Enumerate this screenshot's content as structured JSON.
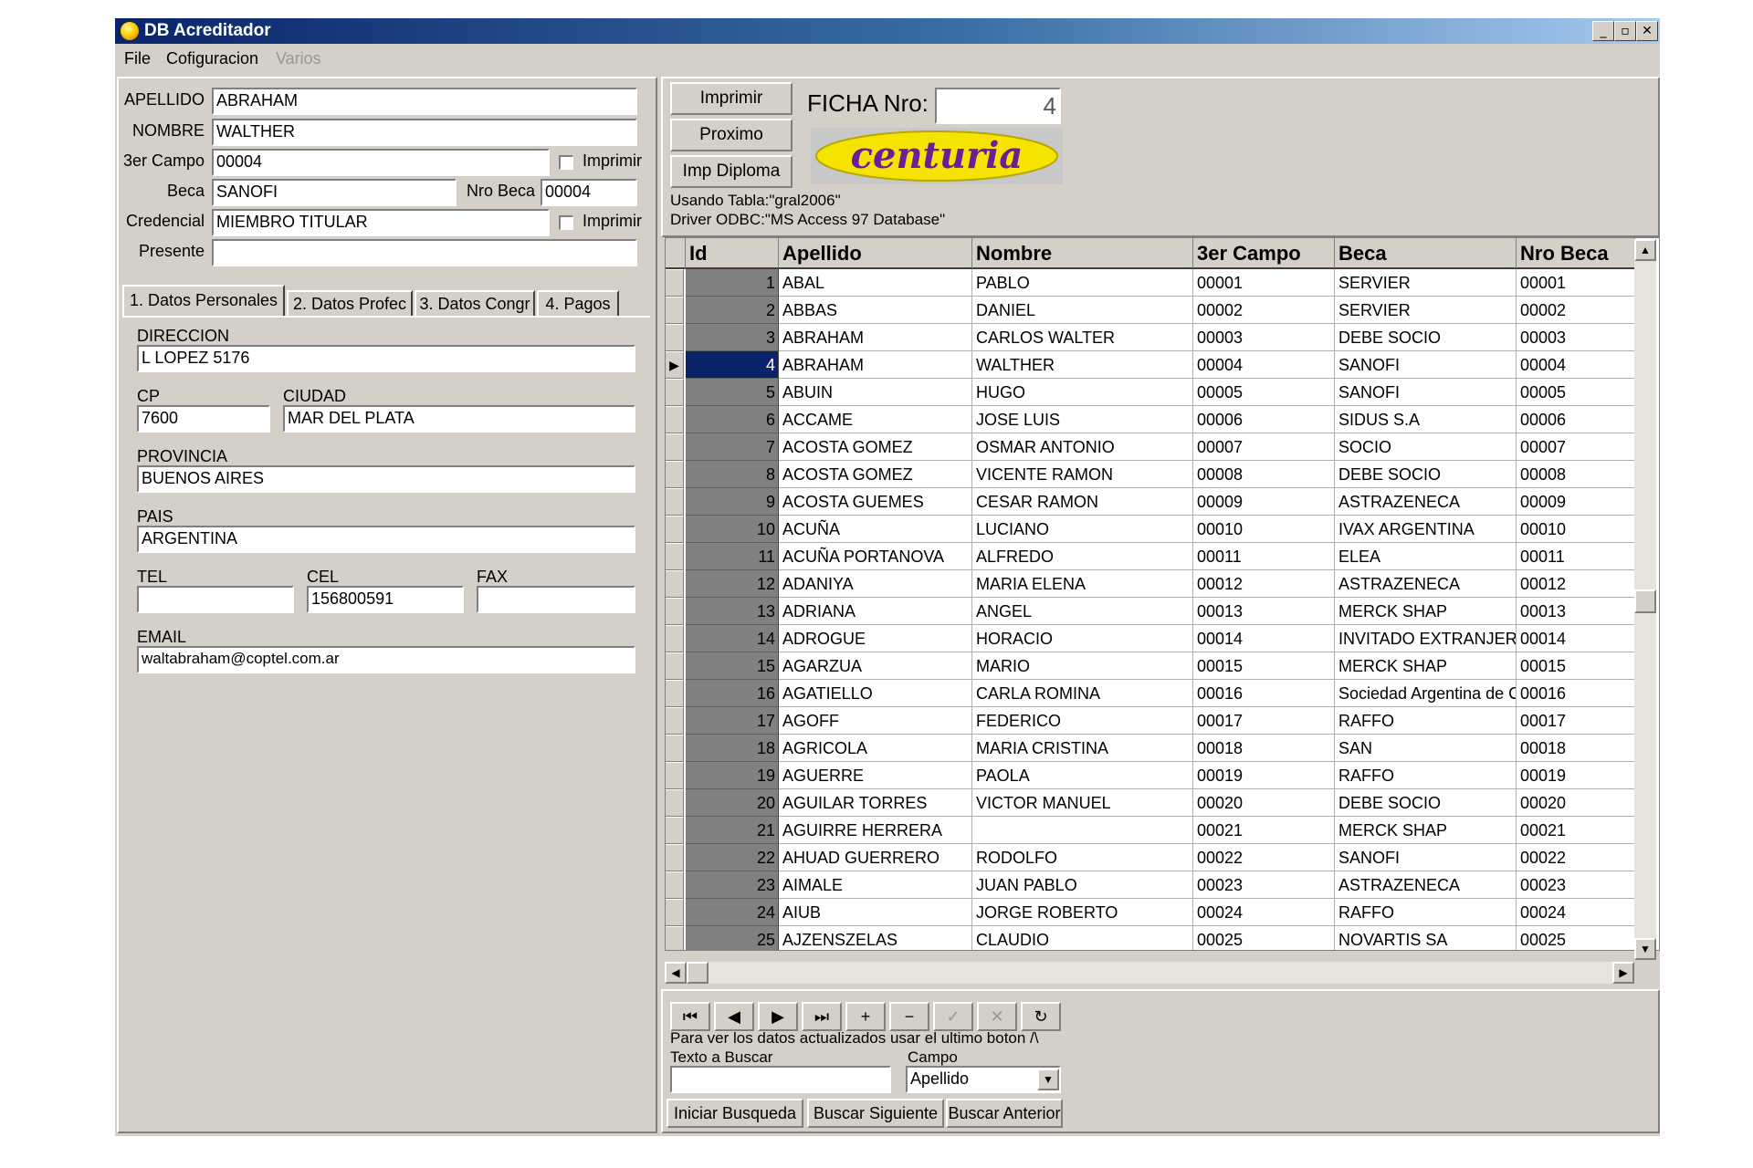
{
  "window": {
    "title": "DB Acreditador",
    "controls": [
      "_",
      "▫",
      "✕"
    ]
  },
  "menu": {
    "items": [
      "File",
      "Cofiguracion"
    ],
    "disabled": "Varios"
  },
  "form": {
    "apellido_label": "APELLIDO",
    "apellido": "ABRAHAM",
    "nombre_label": "NOMBRE",
    "nombre": "WALTHER",
    "campo3_label": "3er Campo",
    "campo3": "00004",
    "imprimir1": "Imprimir",
    "beca_label": "Beca",
    "beca": "SANOFI",
    "nrobeca_label": "Nro Beca",
    "nrobeca": "00004",
    "credencial_label": "Credencial",
    "credencial": "MIEMBRO TITULAR",
    "imprimir2": "Imprimir",
    "presente_label": "Presente",
    "presente": ""
  },
  "tabs": [
    "1. Datos Personales",
    "2. Datos Profec",
    "3. Datos Congr",
    "4. Pagos"
  ],
  "personal": {
    "direccion_label": "DIRECCION",
    "direccion": "L LOPEZ 5176",
    "cp_label": "CP",
    "cp": "7600",
    "ciudad_label": "CIUDAD",
    "ciudad": "MAR DEL PLATA",
    "provincia_label": "PROVINCIA",
    "provincia": "BUENOS AIRES",
    "pais_label": "PAIS",
    "pais": "ARGENTINA",
    "tel_label": "TEL",
    "tel": "",
    "cel_label": "CEL",
    "cel": "156800591",
    "fax_label": "FAX",
    "fax": "",
    "email_label": "EMAIL",
    "email": "waltabraham@coptel.com.ar"
  },
  "actions": {
    "imprimir": "Imprimir",
    "proximo": "Proximo",
    "imp_diploma": "Imp Diploma",
    "ficha_label": "FICHA Nro:",
    "ficha": "4",
    "logo": "centuria"
  },
  "info": {
    "tabla": "Usando Tabla:\"gral2006\"",
    "driver": "Driver ODBC:\"MS Access 97 Database\""
  },
  "grid": {
    "columns": [
      "Id",
      "Apellido",
      "Nombre",
      "3er Campo",
      "Beca",
      "Nro Beca"
    ],
    "selected_id": "4",
    "rows": [
      [
        "1",
        "ABAL",
        "PABLO",
        "00001",
        "SERVIER",
        "00001"
      ],
      [
        "2",
        "ABBAS",
        "DANIEL",
        "00002",
        "SERVIER",
        "00002"
      ],
      [
        "3",
        "ABRAHAM",
        "CARLOS WALTER",
        "00003",
        "DEBE SOCIO",
        "00003"
      ],
      [
        "4",
        "ABRAHAM",
        "WALTHER",
        "00004",
        "SANOFI",
        "00004"
      ],
      [
        "5",
        "ABUIN",
        "HUGO",
        "00005",
        "SANOFI",
        "00005"
      ],
      [
        "6",
        "ACCAME",
        "JOSE LUIS",
        "00006",
        "SIDUS S.A",
        "00006"
      ],
      [
        "7",
        "ACOSTA GOMEZ",
        "OSMAR ANTONIO",
        "00007",
        "SOCIO",
        "00007"
      ],
      [
        "8",
        "ACOSTA GOMEZ",
        "VICENTE RAMON",
        "00008",
        "DEBE SOCIO",
        "00008"
      ],
      [
        "9",
        "ACOSTA GUEMES",
        "CESAR RAMON",
        "00009",
        "ASTRAZENECA",
        "00009"
      ],
      [
        "10",
        "ACUÑA",
        "LUCIANO",
        "00010",
        "IVAX ARGENTINA",
        "00010"
      ],
      [
        "11",
        "ACUÑA PORTANOVA",
        "ALFREDO",
        "00011",
        "ELEA",
        "00011"
      ],
      [
        "12",
        "ADANIYA",
        "MARIA ELENA",
        "00012",
        "ASTRAZENECA",
        "00012"
      ],
      [
        "13",
        "ADRIANA",
        "ANGEL",
        "00013",
        "MERCK SHAP",
        "00013"
      ],
      [
        "14",
        "ADROGUE",
        "HORACIO",
        "00014",
        "INVITADO EXTRANJERO",
        "00014"
      ],
      [
        "15",
        "AGARZUA",
        "MARIO",
        "00015",
        "MERCK SHAP",
        "00015"
      ],
      [
        "16",
        "AGATIELLO",
        "CARLA ROMINA",
        "00016",
        "Sociedad Argentina de C",
        "00016"
      ],
      [
        "17",
        "AGOFF",
        "FEDERICO",
        "00017",
        "RAFFO",
        "00017"
      ],
      [
        "18",
        "AGRICOLA",
        "MARIA CRISTINA",
        "00018",
        "SAN",
        "00018"
      ],
      [
        "19",
        "AGUERRE",
        "PAOLA",
        "00019",
        "RAFFO",
        "00019"
      ],
      [
        "20",
        "AGUILAR TORRES",
        "VICTOR MANUEL",
        "00020",
        "DEBE SOCIO",
        "00020"
      ],
      [
        "21",
        "AGUIRRE HERRERA",
        "",
        "00021",
        "MERCK SHAP",
        "00021"
      ],
      [
        "22",
        "AHUAD GUERRERO",
        "RODOLFO",
        "00022",
        "SANOFI",
        "00022"
      ],
      [
        "23",
        "AIMALE",
        "JUAN PABLO",
        "00023",
        "ASTRAZENECA",
        "00023"
      ],
      [
        "24",
        "AIUB",
        "JORGE ROBERTO",
        "00024",
        "RAFFO",
        "00024"
      ],
      [
        "25",
        "AJZENSZELAS",
        "CLAUDIO",
        "00025",
        "NOVARTIS SA",
        "00025"
      ]
    ]
  },
  "navigator": {
    "buttons": [
      "first-icon",
      "prior-icon",
      "next-icon",
      "last-icon",
      "insert-icon",
      "delete-icon",
      "post-icon",
      "cancel-icon",
      "refresh-icon"
    ],
    "glyphs": [
      "⏮",
      "◀",
      "▶",
      "⏭",
      "+",
      "−",
      "✓",
      "✕",
      "↻"
    ]
  },
  "search": {
    "hint": "Para ver los datos actualizados usar el ultimo boton /\\",
    "texto_label": "Texto a Buscar",
    "texto": "",
    "campo_label": "Campo",
    "campo": "Apellido",
    "iniciar": "Iniciar Busqueda",
    "siguiente": "Buscar Siguiente",
    "anterior": "Buscar Anterior"
  }
}
